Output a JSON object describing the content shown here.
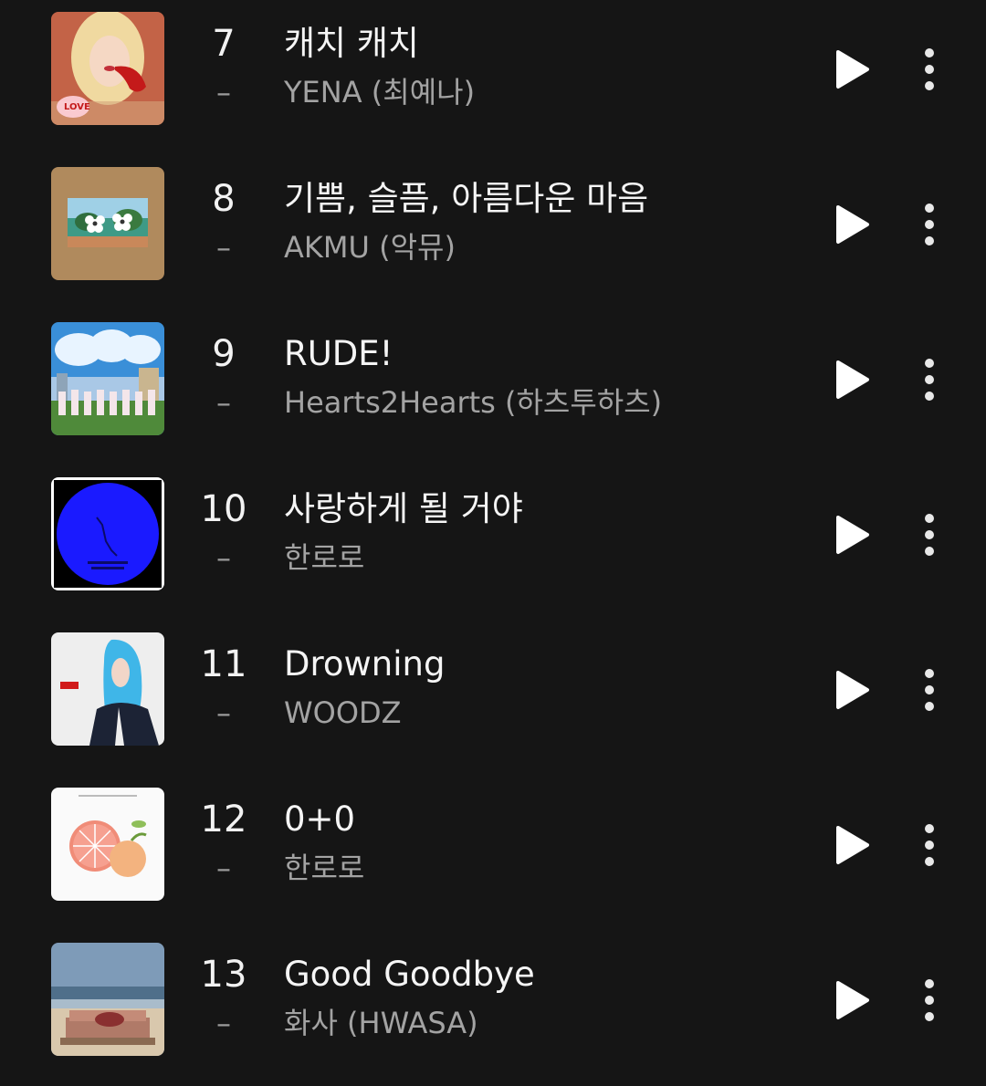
{
  "chart_list": {
    "items": [
      {
        "rank": "7",
        "change": "–",
        "title": "캐치 캐치",
        "artist": "YENA (최예나)",
        "cover": "love-catcher-cover",
        "cover_colors": [
          "#b8432b",
          "#f0d9a0",
          "#c41a1a"
        ]
      },
      {
        "rank": "8",
        "change": "–",
        "title": "기쁨, 슬픔, 아름다운 마음",
        "artist": "AKMU (악뮤)",
        "cover": "flowers-cardboard-cover",
        "cover_colors": [
          "#b08a5d",
          "#3e9a86",
          "#ffffff"
        ]
      },
      {
        "rank": "9",
        "change": "–",
        "title": "RUDE!",
        "artist": "Hearts2Hearts (하츠투하츠)",
        "cover": "rude-clouds-cover",
        "cover_colors": [
          "#3a8fd8",
          "#e8f4ff",
          "#4f8a3a"
        ]
      },
      {
        "rank": "10",
        "change": "–",
        "title": "사랑하게 될 거야",
        "artist": "한로로",
        "cover": "blue-circle-cover",
        "cover_colors": [
          "#000000",
          "#1a1aff",
          "#ffffff"
        ]
      },
      {
        "rank": "11",
        "change": "–",
        "title": "Drowning",
        "artist": "WOODZ",
        "cover": "blue-hair-portrait-cover",
        "cover_colors": [
          "#eeeeee",
          "#3fb6e8",
          "#1c2335"
        ]
      },
      {
        "rank": "12",
        "change": "–",
        "title": "0+0",
        "artist": "한로로",
        "cover": "grapefruit-peach-cover",
        "cover_colors": [
          "#fafafa",
          "#f08c78",
          "#f3b37f"
        ]
      },
      {
        "rank": "13",
        "change": "–",
        "title": "Good Goodbye",
        "artist": "화사 (HWASA)",
        "cover": "beach-sofa-cover",
        "cover_colors": [
          "#7e9bb8",
          "#d9c8ad",
          "#8a3030"
        ]
      }
    ],
    "controls": {
      "play_icon": "play-icon",
      "more_icon": "more-vertical-icon"
    }
  }
}
